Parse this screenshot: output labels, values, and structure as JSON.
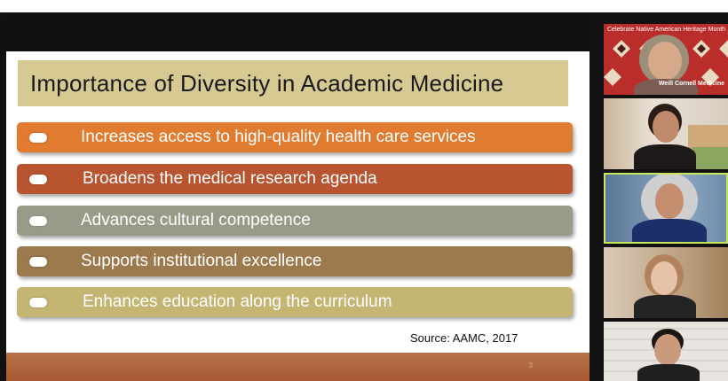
{
  "slide": {
    "title": "Importance of Diversity in Academic Medicine",
    "bullets": [
      {
        "text": "Increases access to high-quality health care services",
        "color": "#e07b2f"
      },
      {
        "text": "Broadens the medical research agenda",
        "color": "#b8542f"
      },
      {
        "text": "Advances cultural competence",
        "color": "#9a9a88"
      },
      {
        "text": "Supports institutional excellence",
        "color": "#9c7a4e"
      },
      {
        "text": "Enhances education along the curriculum",
        "color": "#c4b572"
      }
    ],
    "source": "Source: AAMC, 2017",
    "page_number": "3"
  },
  "participants": {
    "tile1": {
      "banner": "Celebrate Native American Heritage Month",
      "logo": "Weill Cornell Medicine"
    }
  },
  "colors": {
    "title_bg": "#d6ca92",
    "footer_band": "#b0643e",
    "active_speaker_border": "#c8e85a"
  }
}
